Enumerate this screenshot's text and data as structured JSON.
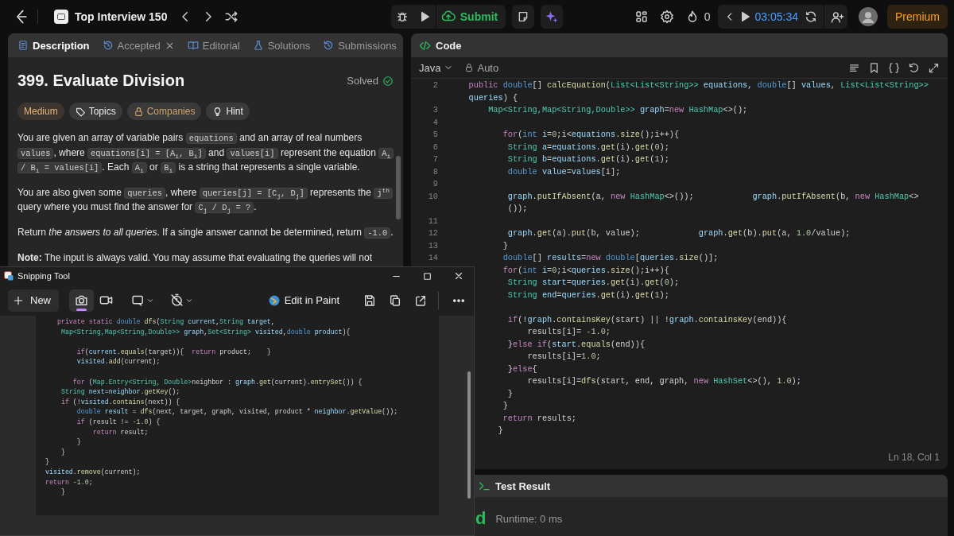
{
  "top_bar": {
    "problem_list": "Top Interview 150",
    "submit": "Submit",
    "streak": "0",
    "timer": "03:05:34",
    "premium": "Premium"
  },
  "description_panel": {
    "tabs": [
      {
        "label": "Description",
        "selected": true,
        "closable": false
      },
      {
        "label": "Accepted",
        "selected": false,
        "closable": true
      },
      {
        "label": "Editorial",
        "selected": false,
        "closable": false
      },
      {
        "label": "Solutions",
        "selected": false,
        "closable": false
      },
      {
        "label": "Submissions",
        "selected": false,
        "closable": false
      }
    ],
    "title": "399. Evaluate Division",
    "status": "Solved",
    "tags": [
      {
        "label": "Medium",
        "kind": "difficulty"
      },
      {
        "label": "Topics",
        "kind": "topics"
      },
      {
        "label": "Companies",
        "kind": "companies"
      },
      {
        "label": "Hint",
        "kind": "hint"
      }
    ],
    "paragraphs": [
      [
        {
          "kind": "text",
          "text": "You are given an array of variable pairs "
        },
        {
          "kind": "code",
          "text": "equations"
        },
        {
          "kind": "text",
          "text": " and an array of real numbers "
        },
        {
          "kind": "code",
          "text": "values"
        },
        {
          "kind": "text",
          "text": ", where "
        },
        {
          "kind": "code",
          "text": "equations[i] = [A$_{i}$, B$_{i}$]"
        },
        {
          "kind": "text",
          "text": " and "
        },
        {
          "kind": "code",
          "text": "values[i]"
        },
        {
          "kind": "text",
          "text": " represent the equation "
        },
        {
          "kind": "code",
          "text": "A$_{i}$ / B$_{i}$ = values[i]"
        },
        {
          "kind": "text",
          "text": ". Each "
        },
        {
          "kind": "code",
          "text": "A$_{i}$"
        },
        {
          "kind": "text",
          "text": " or "
        },
        {
          "kind": "code",
          "text": "B$_{i}$"
        },
        {
          "kind": "text",
          "text": " is a string that represents a single variable."
        }
      ],
      [
        {
          "kind": "text",
          "text": "You are also given some "
        },
        {
          "kind": "code",
          "text": "queries"
        },
        {
          "kind": "text",
          "text": ", where "
        },
        {
          "kind": "code",
          "text": "queries[j] = [C$_{j}$, D$_{j}$]"
        },
        {
          "kind": "text",
          "text": " represents the "
        },
        {
          "kind": "code",
          "text": "j$^{th}$"
        },
        {
          "kind": "text",
          "text": " query where you must find the answer for "
        },
        {
          "kind": "code",
          "text": "C$_{j}$ / D$_{j}$ = ?"
        },
        {
          "kind": "text",
          "text": "."
        }
      ],
      [
        {
          "kind": "text",
          "text": "Return *the answers to all queries*. If a single answer cannot be determined, return "
        },
        {
          "kind": "code",
          "text": "-1.0"
        },
        {
          "kind": "text",
          "text": "."
        }
      ],
      [
        {
          "kind": "text",
          "text": "**Note:** The input is always valid. You may assume that evaluating the queries will not"
        }
      ]
    ]
  },
  "code_panel": {
    "title": "Code",
    "language": "Java",
    "mode": "Auto",
    "cursor": "Ln 18, Col 1",
    "lines": [
      {
        "number": "2",
        "rows": [
          [
            {
              "kind": "kw",
              "text": "    public "
            },
            {
              "kind": "prim",
              "text": "double"
            },
            {
              "kind": "plain",
              "text": "[] "
            },
            {
              "kind": "fn",
              "text": "calcEquation"
            },
            {
              "kind": "plain",
              "text": "("
            },
            {
              "kind": "type",
              "text": "List<List<String>>"
            },
            {
              "kind": "var",
              "text": " equations"
            },
            {
              "kind": "plain",
              "text": ", "
            },
            {
              "kind": "prim",
              "text": "double"
            },
            {
              "kind": "plain",
              "text": "[] "
            },
            {
              "kind": "var",
              "text": "values"
            },
            {
              "kind": "plain",
              "text": ", "
            },
            {
              "kind": "type",
              "text": "List<List<String>>"
            }
          ],
          [
            {
              "kind": "var",
              "text": "    queries"
            },
            {
              "kind": "plain",
              "text": ") {"
            }
          ]
        ]
      },
      {
        "number": "3",
        "rows": [
          [
            {
              "kind": "type",
              "text": "        Map<String,Map<String,Double>>"
            },
            {
              "kind": "var",
              "text": " graph"
            },
            {
              "kind": "plain",
              "text": "="
            },
            {
              "kind": "kw",
              "text": "new "
            },
            {
              "kind": "type",
              "text": "HashMap"
            },
            {
              "kind": "plain",
              "text": "<>();"
            }
          ]
        ]
      },
      {
        "number": "4"
      },
      {
        "number": "5",
        "rows": [
          [
            {
              "kind": "kw",
              "text": "           for"
            },
            {
              "kind": "plain",
              "text": "("
            },
            {
              "kind": "prim",
              "text": "int "
            },
            {
              "kind": "var",
              "text": "i"
            },
            {
              "kind": "plain",
              "text": "="
            },
            {
              "kind": "num",
              "text": "0"
            },
            {
              "kind": "plain",
              "text": ";i<"
            },
            {
              "kind": "var",
              "text": "equations"
            },
            {
              "kind": "plain",
              "text": "."
            },
            {
              "kind": "fn",
              "text": "size"
            },
            {
              "kind": "plain",
              "text": "();i++){"
            }
          ]
        ]
      },
      {
        "number": "6",
        "rows": [
          [
            {
              "kind": "type",
              "text": "            String "
            },
            {
              "kind": "var",
              "text": "a"
            },
            {
              "kind": "plain",
              "text": "="
            },
            {
              "kind": "var",
              "text": "equations"
            },
            {
              "kind": "plain",
              "text": "."
            },
            {
              "kind": "fn",
              "text": "get"
            },
            {
              "kind": "plain",
              "text": "(i)."
            },
            {
              "kind": "fn",
              "text": "get"
            },
            {
              "kind": "plain",
              "text": "("
            },
            {
              "kind": "num",
              "text": "0"
            },
            {
              "kind": "plain",
              "text": ");"
            }
          ]
        ]
      },
      {
        "number": "7",
        "rows": [
          [
            {
              "kind": "type",
              "text": "            String "
            },
            {
              "kind": "var",
              "text": "b"
            },
            {
              "kind": "plain",
              "text": "="
            },
            {
              "kind": "var",
              "text": "equations"
            },
            {
              "kind": "plain",
              "text": "."
            },
            {
              "kind": "fn",
              "text": "get"
            },
            {
              "kind": "plain",
              "text": "(i)."
            },
            {
              "kind": "fn",
              "text": "get"
            },
            {
              "kind": "plain",
              "text": "("
            },
            {
              "kind": "num",
              "text": "1"
            },
            {
              "kind": "plain",
              "text": ");"
            }
          ]
        ]
      },
      {
        "number": "8",
        "rows": [
          [
            {
              "kind": "prim",
              "text": "            double "
            },
            {
              "kind": "var",
              "text": "value"
            },
            {
              "kind": "plain",
              "text": "="
            },
            {
              "kind": "var",
              "text": "values"
            },
            {
              "kind": "plain",
              "text": "[i];"
            }
          ]
        ]
      },
      {
        "number": "9"
      },
      {
        "number": "10",
        "rows": [
          [
            {
              "kind": "var",
              "text": "            graph"
            },
            {
              "kind": "plain",
              "text": "."
            },
            {
              "kind": "fn",
              "text": "putIfAbsent"
            },
            {
              "kind": "plain",
              "text": "(a, "
            },
            {
              "kind": "kw",
              "text": "new "
            },
            {
              "kind": "type",
              "text": "HashMap"
            },
            {
              "kind": "plain",
              "text": "<>());            "
            },
            {
              "kind": "var",
              "text": "graph"
            },
            {
              "kind": "plain",
              "text": "."
            },
            {
              "kind": "fn",
              "text": "putIfAbsent"
            },
            {
              "kind": "plain",
              "text": "(b, "
            },
            {
              "kind": "kw",
              "text": "new "
            },
            {
              "kind": "type",
              "text": "HashMap"
            },
            {
              "kind": "plain",
              "text": "<>"
            }
          ],
          [
            {
              "kind": "plain",
              "text": "            ());"
            }
          ]
        ]
      },
      {
        "number": "11"
      },
      {
        "number": "12",
        "rows": [
          [
            {
              "kind": "var",
              "text": "            graph"
            },
            {
              "kind": "plain",
              "text": "."
            },
            {
              "kind": "fn",
              "text": "get"
            },
            {
              "kind": "plain",
              "text": "(a)."
            },
            {
              "kind": "fn",
              "text": "put"
            },
            {
              "kind": "plain",
              "text": "(b, value);            "
            },
            {
              "kind": "var",
              "text": "graph"
            },
            {
              "kind": "plain",
              "text": "."
            },
            {
              "kind": "fn",
              "text": "get"
            },
            {
              "kind": "plain",
              "text": "(b)."
            },
            {
              "kind": "fn",
              "text": "put"
            },
            {
              "kind": "plain",
              "text": "(a, "
            },
            {
              "kind": "num",
              "text": "1.0"
            },
            {
              "kind": "plain",
              "text": "/value);"
            }
          ]
        ]
      },
      {
        "number": "13",
        "rows": [
          [
            {
              "kind": "plain",
              "text": "           }"
            }
          ]
        ]
      },
      {
        "number": "14",
        "rows": [
          [
            {
              "kind": "prim",
              "text": "           double"
            },
            {
              "kind": "plain",
              "text": "[] "
            },
            {
              "kind": "var",
              "text": "results"
            },
            {
              "kind": "plain",
              "text": "="
            },
            {
              "kind": "kw",
              "text": "new "
            },
            {
              "kind": "prim",
              "text": "double"
            },
            {
              "kind": "plain",
              "text": "["
            },
            {
              "kind": "var",
              "text": "queries"
            },
            {
              "kind": "plain",
              "text": "."
            },
            {
              "kind": "fn",
              "text": "size"
            },
            {
              "kind": "plain",
              "text": "()];"
            }
          ]
        ]
      },
      {
        "rows": [
          [
            {
              "kind": "kw",
              "text": "           for"
            },
            {
              "kind": "plain",
              "text": "("
            },
            {
              "kind": "prim",
              "text": "int "
            },
            {
              "kind": "var",
              "text": "i"
            },
            {
              "kind": "plain",
              "text": "="
            },
            {
              "kind": "num",
              "text": "0"
            },
            {
              "kind": "plain",
              "text": ";i<"
            },
            {
              "kind": "var",
              "text": "queries"
            },
            {
              "kind": "plain",
              "text": "."
            },
            {
              "kind": "fn",
              "text": "size"
            },
            {
              "kind": "plain",
              "text": "();i++){"
            }
          ]
        ]
      },
      {
        "rows": [
          [
            {
              "kind": "type",
              "text": "            String "
            },
            {
              "kind": "var",
              "text": "start"
            },
            {
              "kind": "plain",
              "text": "="
            },
            {
              "kind": "var",
              "text": "queries"
            },
            {
              "kind": "plain",
              "text": "."
            },
            {
              "kind": "fn",
              "text": "get"
            },
            {
              "kind": "plain",
              "text": "(i)."
            },
            {
              "kind": "fn",
              "text": "get"
            },
            {
              "kind": "plain",
              "text": "("
            },
            {
              "kind": "num",
              "text": "0"
            },
            {
              "kind": "plain",
              "text": ");"
            }
          ]
        ]
      },
      {
        "rows": [
          [
            {
              "kind": "type",
              "text": "            String "
            },
            {
              "kind": "var",
              "text": "end"
            },
            {
              "kind": "plain",
              "text": "="
            },
            {
              "kind": "var",
              "text": "queries"
            },
            {
              "kind": "plain",
              "text": "."
            },
            {
              "kind": "fn",
              "text": "get"
            },
            {
              "kind": "plain",
              "text": "(i)."
            },
            {
              "kind": "fn",
              "text": "get"
            },
            {
              "kind": "plain",
              "text": "("
            },
            {
              "kind": "num",
              "text": "1"
            },
            {
              "kind": "plain",
              "text": ");"
            }
          ]
        ]
      },
      {
        "gap_before": true,
        "rows": [
          [
            {
              "kind": "kw",
              "text": "            if"
            },
            {
              "kind": "plain",
              "text": "(!"
            },
            {
              "kind": "var",
              "text": "graph"
            },
            {
              "kind": "plain",
              "text": "."
            },
            {
              "kind": "fn",
              "text": "containsKey"
            },
            {
              "kind": "plain",
              "text": "(start) || !"
            },
            {
              "kind": "var",
              "text": "graph"
            },
            {
              "kind": "plain",
              "text": "."
            },
            {
              "kind": "fn",
              "text": "containsKey"
            },
            {
              "kind": "plain",
              "text": "(end)){"
            }
          ]
        ]
      },
      {
        "rows": [
          [
            {
              "kind": "plain",
              "text": "                results[i]= "
            },
            {
              "kind": "num",
              "text": "-1.0"
            },
            {
              "kind": "plain",
              "text": ";"
            }
          ]
        ]
      },
      {
        "rows": [
          [
            {
              "kind": "plain",
              "text": "            }"
            },
            {
              "kind": "kw",
              "text": "else if"
            },
            {
              "kind": "plain",
              "text": "("
            },
            {
              "kind": "var",
              "text": "start"
            },
            {
              "kind": "plain",
              "text": "."
            },
            {
              "kind": "fn",
              "text": "equals"
            },
            {
              "kind": "plain",
              "text": "(end)){"
            }
          ]
        ]
      },
      {
        "rows": [
          [
            {
              "kind": "plain",
              "text": "                results[i]="
            },
            {
              "kind": "num",
              "text": "1.0"
            },
            {
              "kind": "plain",
              "text": ";"
            }
          ]
        ]
      },
      {
        "rows": [
          [
            {
              "kind": "plain",
              "text": "            }"
            },
            {
              "kind": "kw",
              "text": "else"
            },
            {
              "kind": "plain",
              "text": "{"
            }
          ]
        ]
      },
      {
        "rows": [
          [
            {
              "kind": "plain",
              "text": "                results[i]="
            },
            {
              "kind": "fn",
              "text": "dfs"
            },
            {
              "kind": "plain",
              "text": "(start, end, graph, "
            },
            {
              "kind": "kw",
              "text": "new "
            },
            {
              "kind": "type",
              "text": "HashSet"
            },
            {
              "kind": "plain",
              "text": "<>(), "
            },
            {
              "kind": "num",
              "text": "1.0"
            },
            {
              "kind": "plain",
              "text": ");"
            }
          ]
        ]
      },
      {
        "rows": [
          [
            {
              "kind": "plain",
              "text": "            }"
            }
          ]
        ]
      },
      {
        "rows": [
          [
            {
              "kind": "plain",
              "text": "           }"
            }
          ]
        ]
      },
      {
        "rows": [
          [
            {
              "kind": "kw",
              "text": "           return "
            },
            {
              "kind": "plain",
              "text": "results;"
            }
          ]
        ]
      },
      {
        "rows": [
          [
            {
              "kind": "plain",
              "text": "          }"
            }
          ]
        ]
      }
    ]
  },
  "test_result": {
    "title": "Test Result",
    "status": "d",
    "runtime": "Runtime: 0 ms"
  },
  "snipping_tool": {
    "title": "Snipping Tool",
    "new": "New",
    "capture_modes": [
      {
        "kind": "photo",
        "selected": true
      },
      {
        "kind": "video",
        "selected": false
      }
    ],
    "edit_in_paint": "Edit in Paint",
    "code_lines": [
      {
        "tokens": [
          {
            "kind": "kw",
            "text": "   private static "
          },
          {
            "kind": "prim",
            "text": "double "
          },
          {
            "kind": "fn",
            "text": "dfs"
          },
          {
            "kind": "plain",
            "text": "("
          },
          {
            "kind": "type",
            "text": "String "
          },
          {
            "kind": "var",
            "text": "current"
          },
          {
            "kind": "plain",
            "text": ","
          },
          {
            "kind": "type",
            "text": "String "
          },
          {
            "kind": "var",
            "text": "target"
          },
          {
            "kind": "plain",
            "text": ","
          }
        ]
      },
      {
        "tokens": [
          {
            "kind": "type",
            "text": "    Map<String,Map<String,Double>>"
          },
          {
            "kind": "var",
            "text": " graph"
          },
          {
            "kind": "plain",
            "text": ","
          },
          {
            "kind": "type",
            "text": "Set<String>"
          },
          {
            "kind": "var",
            "text": " visited"
          },
          {
            "kind": "plain",
            "text": ","
          },
          {
            "kind": "prim",
            "text": "double "
          },
          {
            "kind": "var",
            "text": "product"
          },
          {
            "kind": "plain",
            "text": "){"
          }
        ]
      },
      {
        "gap_before": true,
        "tokens": [
          {
            "kind": "kw",
            "text": "        if"
          },
          {
            "kind": "plain",
            "text": "("
          },
          {
            "kind": "var",
            "text": "current"
          },
          {
            "kind": "plain",
            "text": "."
          },
          {
            "kind": "fn",
            "text": "equals"
          },
          {
            "kind": "plain",
            "text": "(target)){  "
          },
          {
            "kind": "kw",
            "text": "return "
          },
          {
            "kind": "plain",
            "text": "product;    }"
          }
        ]
      },
      {
        "tokens": [
          {
            "kind": "var",
            "text": "        visited"
          },
          {
            "kind": "plain",
            "text": "."
          },
          {
            "kind": "fn",
            "text": "add"
          },
          {
            "kind": "plain",
            "text": "(current);"
          }
        ]
      },
      {
        "gap_before": true,
        "tokens": [
          {
            "kind": "kw",
            "text": "       for "
          },
          {
            "kind": "plain",
            "text": "("
          },
          {
            "kind": "type",
            "text": "Map.Entry<String, Double>"
          },
          {
            "kind": "plain",
            "text": "neighbor : "
          },
          {
            "kind": "var",
            "text": "graph"
          },
          {
            "kind": "plain",
            "text": "."
          },
          {
            "kind": "fn",
            "text": "get"
          },
          {
            "kind": "plain",
            "text": "(current)."
          },
          {
            "kind": "fn",
            "text": "entrySet"
          },
          {
            "kind": "plain",
            "text": "()) {"
          }
        ]
      },
      {
        "tokens": [
          {
            "kind": "type",
            "text": "    String "
          },
          {
            "kind": "var",
            "text": "next"
          },
          {
            "kind": "plain",
            "text": "="
          },
          {
            "kind": "var",
            "text": "neighbor"
          },
          {
            "kind": "plain",
            "text": "."
          },
          {
            "kind": "fn",
            "text": "getKey"
          },
          {
            "kind": "plain",
            "text": "();"
          }
        ]
      },
      {
        "tokens": [
          {
            "kind": "kw",
            "text": "    if "
          },
          {
            "kind": "plain",
            "text": "(!"
          },
          {
            "kind": "var",
            "text": "visited"
          },
          {
            "kind": "plain",
            "text": "."
          },
          {
            "kind": "fn",
            "text": "contains"
          },
          {
            "kind": "plain",
            "text": "(next)) {"
          }
        ]
      },
      {
        "tokens": [
          {
            "kind": "prim",
            "text": "        double "
          },
          {
            "kind": "var",
            "text": "result"
          },
          {
            "kind": "plain",
            "text": " = "
          },
          {
            "kind": "fn",
            "text": "dfs"
          },
          {
            "kind": "plain",
            "text": "(next, target, graph, visited, product * "
          },
          {
            "kind": "var",
            "text": "neighbor"
          },
          {
            "kind": "plain",
            "text": "."
          },
          {
            "kind": "fn",
            "text": "getValue"
          },
          {
            "kind": "plain",
            "text": "());"
          }
        ]
      },
      {
        "tokens": [
          {
            "kind": "kw",
            "text": "        if "
          },
          {
            "kind": "plain",
            "text": "(result != "
          },
          {
            "kind": "num",
            "text": "-1.0"
          },
          {
            "kind": "plain",
            "text": ") {"
          }
        ]
      },
      {
        "tokens": [
          {
            "kind": "kw",
            "text": "            return "
          },
          {
            "kind": "plain",
            "text": "result;"
          }
        ]
      },
      {
        "tokens": [
          {
            "kind": "plain",
            "text": "        }"
          }
        ]
      },
      {
        "tokens": [
          {
            "kind": "plain",
            "text": "    }"
          }
        ]
      },
      {
        "tokens": [
          {
            "kind": "plain",
            "text": "}"
          }
        ]
      },
      {
        "tokens": [
          {
            "kind": "var",
            "text": "visited"
          },
          {
            "kind": "plain",
            "text": "."
          },
          {
            "kind": "fn",
            "text": "remove"
          },
          {
            "kind": "plain",
            "text": "(current);"
          }
        ]
      },
      {
        "tokens": [
          {
            "kind": "kw",
            "text": "return "
          },
          {
            "kind": "num",
            "text": "-1.0"
          },
          {
            "kind": "plain",
            "text": ";"
          }
        ]
      },
      {
        "tokens": [
          {
            "kind": "plain",
            "text": "    }"
          }
        ]
      }
    ]
  }
}
